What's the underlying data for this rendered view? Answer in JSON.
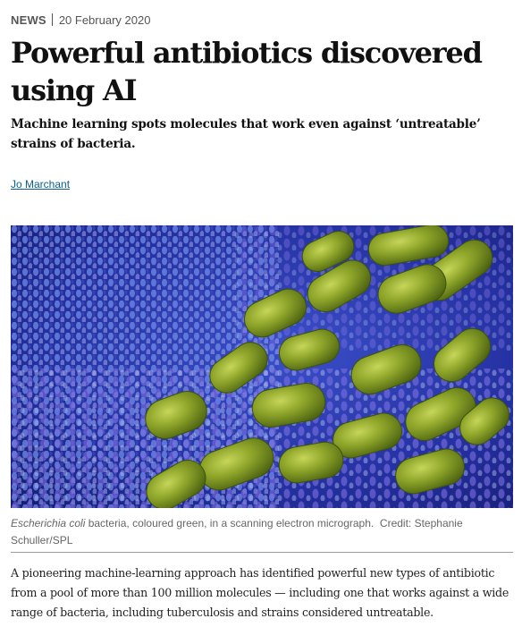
{
  "article": {
    "kicker": "NEWS",
    "date": "20 February 2020",
    "title": "Powerful antibiotics discovered using AI",
    "standfirst": "Machine learning spots molecules that work even against ‘untreatable’ strains of bacteria.",
    "author": "Jo Marchant",
    "image": {
      "caption_species": "Escherichia coli",
      "caption_text": " bacteria, coloured green, in a scanning electron micrograph.",
      "credit": "Credit: Stephanie Schuller/SPL"
    },
    "body": "A pioneering machine-learning approach has identified powerful new types of antibiotic from a pool of more than 100 million molecules — including one that works against a wide range of bacteria, including tuberculosis and strains considered untreatable."
  },
  "colors": {
    "link": "#0a5e91",
    "bacteria_green": "#8fa82a",
    "background_blue": "#2b2fa8"
  }
}
